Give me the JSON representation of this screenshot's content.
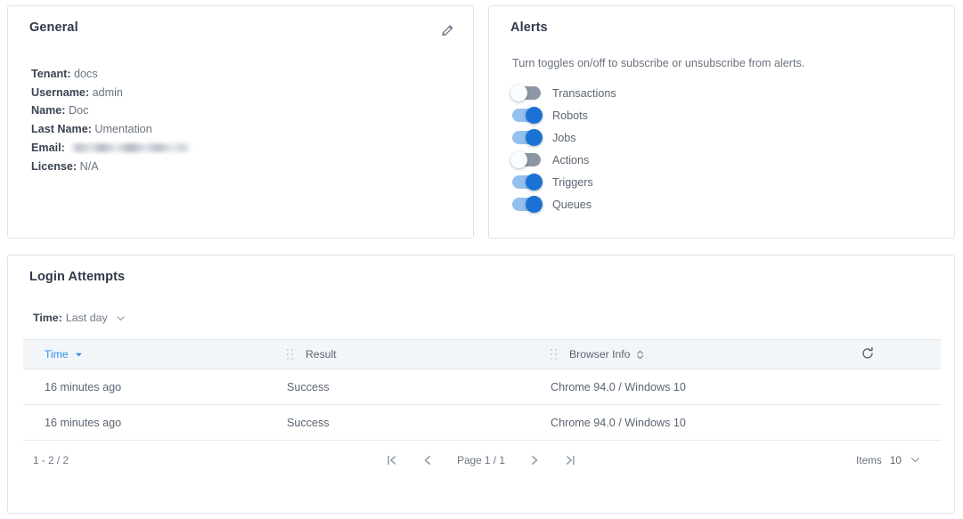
{
  "general": {
    "title": "General",
    "edit_icon": "pencil-icon",
    "fields": [
      {
        "label": "Tenant:",
        "value": "docs"
      },
      {
        "label": "Username:",
        "value": "admin"
      },
      {
        "label": "Name:",
        "value": "Doc"
      },
      {
        "label": "Last Name:",
        "value": "Umentation"
      },
      {
        "label": "Email:",
        "value": "",
        "redacted": true
      },
      {
        "label": "License:",
        "value": "N/A"
      }
    ]
  },
  "alerts": {
    "title": "Alerts",
    "description": "Turn toggles on/off to subscribe or unsubscribe from alerts.",
    "toggles": [
      {
        "label": "Transactions",
        "on": false
      },
      {
        "label": "Robots",
        "on": true
      },
      {
        "label": "Jobs",
        "on": true
      },
      {
        "label": "Actions",
        "on": false
      },
      {
        "label": "Triggers",
        "on": true
      },
      {
        "label": "Queues",
        "on": true
      }
    ]
  },
  "login_attempts": {
    "title": "Login Attempts",
    "filter": {
      "key": "Time:",
      "value": "Last day",
      "chevron_icon": "chevron-down-icon"
    },
    "refresh_icon": "refresh-icon",
    "columns": [
      {
        "label": "Time",
        "sort": "desc",
        "active": true,
        "grip": false
      },
      {
        "label": "Result",
        "sort": "none",
        "active": false,
        "grip": true
      },
      {
        "label": "Browser Info",
        "sort": "both",
        "active": false,
        "grip": true
      }
    ],
    "rows": [
      {
        "time": "16 minutes ago",
        "result": "Success",
        "browser": "Chrome 94.0 / Windows 10"
      },
      {
        "time": "16 minutes ago",
        "result": "Success",
        "browser": "Chrome 94.0 / Windows 10"
      }
    ],
    "pagination": {
      "count": "1 - 2 / 2",
      "page_label": "Page 1 / 1",
      "first_icon": "first-page-icon",
      "prev_icon": "previous-page-icon",
      "next_icon": "next-page-icon",
      "last_icon": "last-page-icon",
      "items_label": "Items",
      "items_value": "10",
      "items_chevron_icon": "chevron-down-icon"
    }
  },
  "colors": {
    "accent_blue": "#2d8cf0",
    "toggle_on_knob": "#1a73d4",
    "toggle_on_track": "#93c0ee",
    "toggle_off_track": "#8d97a4",
    "card_border": "#dfe3e8",
    "header_bg": "#f3f6f9",
    "text": "#5b6572",
    "title": "#2f3a4a"
  }
}
